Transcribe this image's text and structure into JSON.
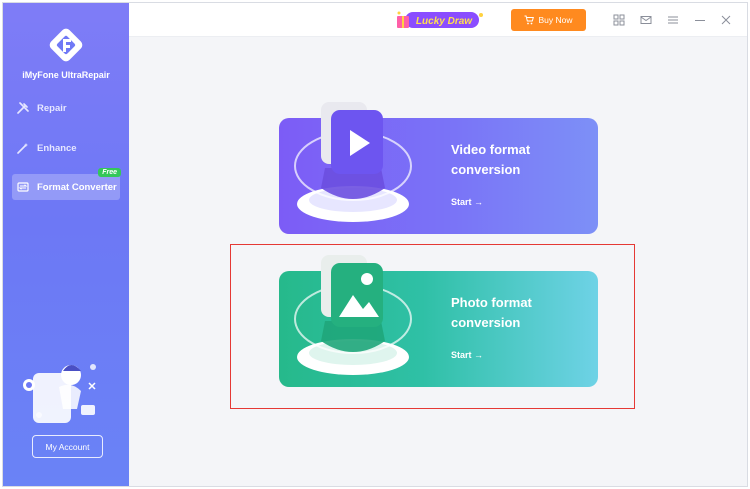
{
  "app": {
    "name": "iMyFone UltraRepair"
  },
  "sidebar": {
    "items": [
      {
        "label": "Repair",
        "icon": "repair-tools-icon"
      },
      {
        "label": "Enhance",
        "icon": "magic-wand-icon"
      },
      {
        "label": "Format Converter",
        "icon": "format-convert-icon",
        "badge": "Free",
        "active": true
      }
    ],
    "account_label": "My Account"
  },
  "titlebar": {
    "promo_label": "Lucky Draw",
    "buy_label": "Buy Now",
    "icons": [
      "grid-menu-icon",
      "mail-icon",
      "hamburger-menu-icon",
      "minimize-icon",
      "close-icon"
    ]
  },
  "main": {
    "cards": [
      {
        "title_line1": "Video format",
        "title_line2": "conversion",
        "start_label": "Start →",
        "icon": "video-play-icon"
      },
      {
        "title_line1": "Photo format",
        "title_line2": "conversion",
        "start_label": "Start →",
        "icon": "photo-image-icon"
      }
    ]
  },
  "colors": {
    "sidebar": "#7079f6",
    "buy_button": "#ff8a1f",
    "free_badge": "#34c759",
    "highlight_border": "#e53935",
    "video_card": "#7c5cf6",
    "photo_card": "#26b98b"
  }
}
